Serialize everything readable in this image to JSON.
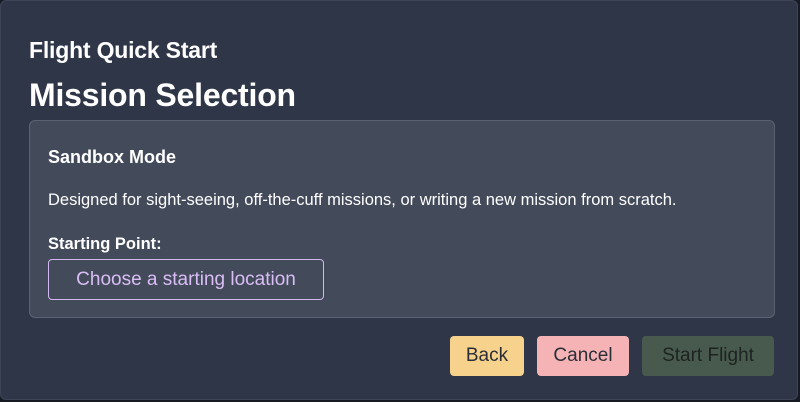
{
  "dialog": {
    "subtitle": "Flight Quick Start",
    "title": "Mission Selection"
  },
  "mode": {
    "name": "Sandbox Mode",
    "description": "Designed for sight-seeing, off-the-cuff missions, or writing a new mission from scratch.",
    "starting_point_label": "Starting Point:",
    "location_button_label": "Choose a starting location"
  },
  "actions": {
    "back_label": "Back",
    "cancel_label": "Cancel",
    "start_label": "Start Flight"
  },
  "colors": {
    "background": "#2f3648",
    "card": "#434a5a",
    "accent_purple": "#d9bdf5",
    "back_button": "#f6d28c",
    "cancel_button": "#f5b3b6",
    "start_button": "#485a4d"
  }
}
